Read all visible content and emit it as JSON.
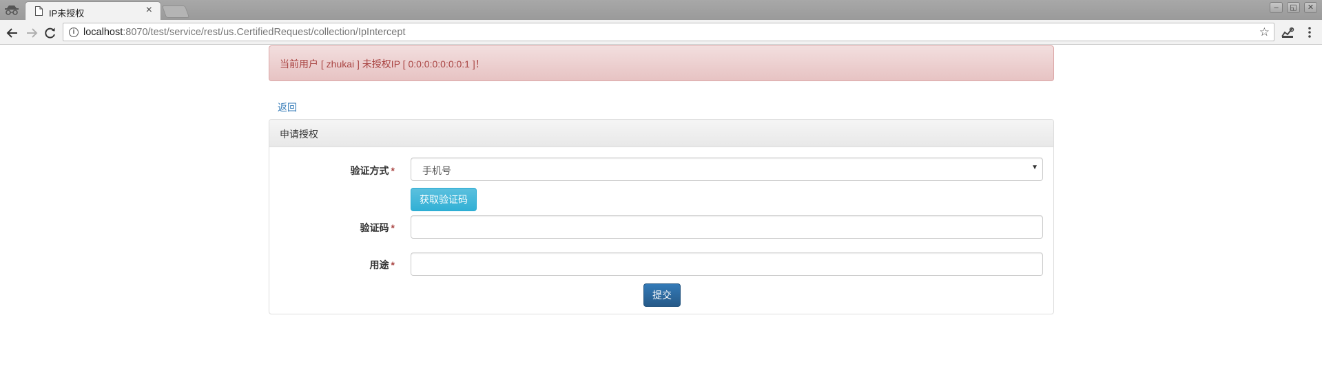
{
  "browser": {
    "tab_title": "IP未授权",
    "tab_close": "×",
    "url_host": "localhost",
    "url_rest": ":8070/test/service/rest/us.CertifiedRequest/collection/IpIntercept",
    "info_glyph": "i",
    "star_glyph": "☆",
    "window_controls": [
      "–",
      "◱",
      "✕"
    ]
  },
  "alert": {
    "message": "当前用户 [ zhukai ] 未授权IP [ 0:0:0:0:0:0:0:1 ]！"
  },
  "page": {
    "back_label": "返回"
  },
  "panel": {
    "title": "申请授权",
    "required_mark": "*",
    "fields": {
      "method": {
        "label": "验证方式",
        "value": "手机号"
      },
      "code": {
        "label": "验证码",
        "value": ""
      },
      "purpose": {
        "label": "用途",
        "value": ""
      }
    },
    "get_code_button": "获取验证码",
    "submit_button": "提交"
  },
  "colors": {
    "alert_text": "#a94442",
    "link": "#337ab7",
    "info_button": "#5bc0de",
    "primary_button": "#337ab7"
  }
}
